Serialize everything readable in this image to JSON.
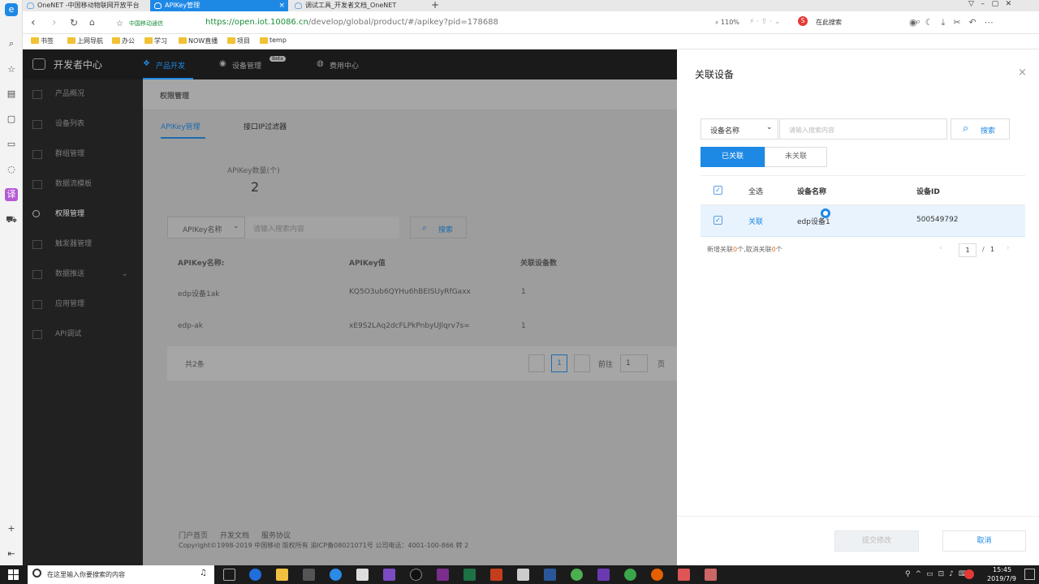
{
  "browser": {
    "tabs": [
      {
        "title": "OneNET -中国移动物联网开放平台"
      },
      {
        "title": "APIKey管理"
      },
      {
        "title": "调试工具_开发者文档_OneNET"
      }
    ],
    "new_tab": "+",
    "url_host": "https://open.iot.10086.cn",
    "url_path": "/develop/global/product/#/apikey?pid=178688",
    "site_badge": "中国移动通信",
    "zoom": "110%",
    "search_placeholder": "在此搜索",
    "bookmarks": [
      "书签",
      "上网导航",
      "办公",
      "学习",
      "NOW直播",
      "项目",
      "temp"
    ]
  },
  "console": {
    "brand": "开发者中心",
    "top_nav": [
      "产品开发",
      "设备管理",
      "费用中心"
    ],
    "beta": "Beta",
    "sidebar": [
      "产品概况",
      "设备列表",
      "群组管理",
      "数据流模板",
      "权限管理",
      "触发器管理",
      "数据推送",
      "应用管理",
      "API调试"
    ],
    "page_title": "权限管理",
    "tabs": [
      "APIKey管理",
      "接口IP过滤器"
    ],
    "stat_label": "APIKey数量(个)",
    "stat_value": "2",
    "filter_select": "APIKey名称",
    "filter_placeholder": "请输入搜索内容",
    "search_label": "搜索",
    "table_headers": [
      "APIKey名称:",
      "APIKey值",
      "关联设备数"
    ],
    "rows": [
      {
        "name": "edp设备1ak",
        "key": "KQ5O3ub6QYHu6hBEISUyRfGaxx4=",
        "count": "1"
      },
      {
        "name": "edp-ak",
        "key": "xE9S2LAq2dcFLPkPnbyUJlqrv7s=",
        "count": "1"
      }
    ],
    "total": "共2条",
    "page_current": "1",
    "goto_label": "前往",
    "goto_value": "1",
    "goto_suffix": "页",
    "footer_links": [
      "门户首页",
      "开发文档",
      "服务协议"
    ],
    "copyright": "Copyright©1998-2019 中国移动 版权所有 渝ICP备08021071号 公司电话：4001-100-866 转 2"
  },
  "drawer": {
    "title": "关联设备",
    "close": "×",
    "select_value": "设备名称",
    "search_placeholder": "请输入搜索内容",
    "search_label": "搜索",
    "seg_linked": "已关联",
    "seg_unlinked": "未关联",
    "headers": {
      "all": "全选",
      "name": "设备名称",
      "id": "设备ID"
    },
    "row": {
      "status": "关联",
      "name": "edp设备1",
      "id": "500549792"
    },
    "summary_prefix": "新增关联",
    "summary_added": "0",
    "summary_mid": "个,取消关联",
    "summary_removed": "0",
    "summary_suffix": "个",
    "page_current": "1",
    "page_sep": "/",
    "page_total": "1",
    "submit_label": "提交修改",
    "cancel_label": "取消"
  },
  "taskbar": {
    "search_placeholder": "在这里输入你要搜索的内容",
    "time": "15:45",
    "date": "2019/7/9"
  },
  "colors": {
    "accent": "#1e88e5",
    "dark_header": "#1a1a1a",
    "sidebar": "#212121",
    "overlay": "#9d9d9d"
  }
}
